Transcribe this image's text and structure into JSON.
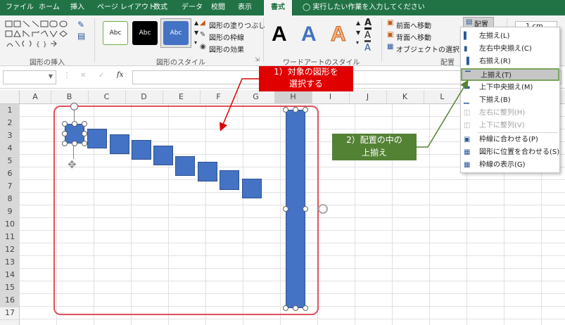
{
  "tabs": [
    "ファイル",
    "ホーム",
    "挿入",
    "ページ レイアウト",
    "数式",
    "データ",
    "校閲",
    "表示",
    "書式"
  ],
  "active_tab": "書式",
  "search_hint": "実行したい作業を入力してください",
  "ribbon": {
    "group_insert_shapes": "図形の挿入",
    "group_shape_styles": "図形のスタイル",
    "group_wordart": "ワードアートのスタイル",
    "group_arrange": "配置",
    "style_sample": "Abc",
    "wordart_sample": "A",
    "fill": "図形の塗りつぶし",
    "outline": "図形の枠線",
    "effects": "図形の効果",
    "bring_forward": "前面へ移動",
    "send_backward": "背面へ移動",
    "selection_pane": "オブジェクトの選択と表示",
    "align_button": "配置",
    "size_value": "1 cm"
  },
  "formula_bar": {
    "fx": "fx"
  },
  "columns": [
    "A",
    "B",
    "C",
    "D",
    "E",
    "F",
    "G",
    "H",
    "I",
    "J",
    "K",
    "L",
    "M"
  ],
  "rows": [
    "1",
    "2",
    "3",
    "4",
    "5",
    "6",
    "7",
    "8",
    "9",
    "10",
    "11",
    "12",
    "13",
    "14",
    "15",
    "16",
    "17"
  ],
  "align_menu": [
    {
      "label": "左揃え(L)",
      "icon": "align-left-icon",
      "enabled": true
    },
    {
      "label": "左右中央揃え(C)",
      "icon": "align-center-icon",
      "enabled": true
    },
    {
      "label": "右揃え(R)",
      "icon": "align-right-icon",
      "enabled": true
    },
    {
      "label": "上揃え(T)",
      "icon": "align-top-icon",
      "enabled": true,
      "highlighted": true
    },
    {
      "label": "上下中央揃え(M)",
      "icon": "align-middle-icon",
      "enabled": true
    },
    {
      "label": "下揃え(B)",
      "icon": "align-bottom-icon",
      "enabled": true
    },
    {
      "label": "左右に整列(H)",
      "icon": "distribute-horizontal-icon",
      "enabled": false
    },
    {
      "label": "上下に整列(V)",
      "icon": "distribute-vertical-icon",
      "enabled": false
    },
    {
      "label": "枠線に合わせる(P)",
      "icon": "snap-to-grid-icon",
      "enabled": true
    },
    {
      "label": "図形に位置を合わせる(S)",
      "icon": "snap-to-shape-icon",
      "enabled": true
    },
    {
      "label": "枠線の表示(G)",
      "icon": "view-gridlines-icon",
      "enabled": true
    }
  ],
  "callouts": {
    "step1_line1": "1）対象の図形を",
    "step1_line2": "選択する",
    "step2_line1": "2）配置の中の",
    "step2_line2": "上揃え"
  },
  "colors": {
    "excel_green": "#217346",
    "shape_blue": "#4472c4",
    "callout_red": "#e00000",
    "callout_green": "#548235",
    "selection_red": "#e0505a"
  }
}
